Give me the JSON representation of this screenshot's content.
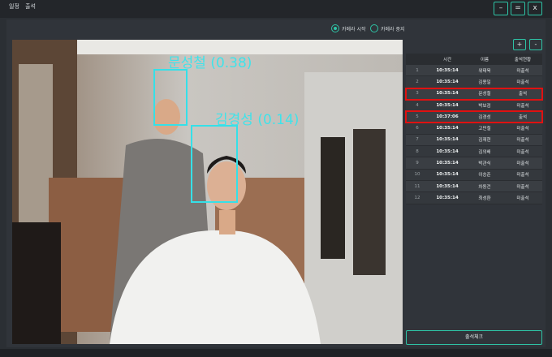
{
  "menu": [
    "일정",
    "출석"
  ],
  "window_buttons": [
    "–",
    "=",
    "x"
  ],
  "camera_controls": {
    "start_label": "카메라 시작",
    "stop_label": "카메라 중지"
  },
  "faces": [
    {
      "label": "문성철 (0.38)"
    },
    {
      "label": "김경성 (0.14)"
    }
  ],
  "table_buttons": [
    "+",
    "-"
  ],
  "table": {
    "headers": [
      "",
      "시간",
      "이름",
      "출석현황"
    ],
    "rows": [
      [
        "1",
        "10:35:14",
        "위태욱",
        "미출석"
      ],
      [
        "2",
        "10:35:14",
        "김용일",
        "미출석"
      ],
      [
        "3",
        "10:35:14",
        "문성철",
        "출석"
      ],
      [
        "4",
        "10:35:14",
        "박보검",
        "미출석"
      ],
      [
        "5",
        "10:37:06",
        "김경성",
        "출석"
      ],
      [
        "6",
        "10:35:14",
        "고민철",
        "미출석"
      ],
      [
        "7",
        "10:35:14",
        "김재현",
        "미출석"
      ],
      [
        "8",
        "10:35:14",
        "김의배",
        "미출석"
      ],
      [
        "9",
        "10:35:14",
        "박관식",
        "미출석"
      ],
      [
        "10",
        "10:35:14",
        "이승준",
        "미출석"
      ],
      [
        "11",
        "10:35:14",
        "차동건",
        "미출석"
      ],
      [
        "12",
        "10:35:14",
        "최성환",
        "미출석"
      ]
    ]
  },
  "check_button": "출석체크",
  "accent_color": "#2ec4a6",
  "highlight_color": "#e01111"
}
